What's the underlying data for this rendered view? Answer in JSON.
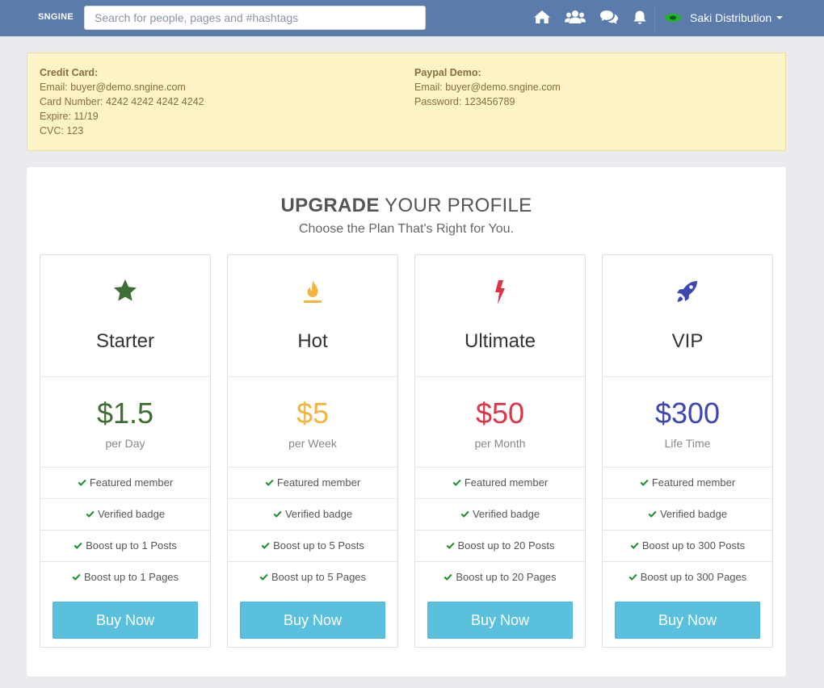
{
  "header": {
    "logo": "SNGINE",
    "search_placeholder": "Search for people, pages and #hashtags",
    "user_name": "Saki Distribution"
  },
  "demo_notice": {
    "credit_card": {
      "title": "Credit Card:",
      "email": "Email: buyer@demo.sngine.com",
      "card_number": "Card Number: 4242 4242 4242 4242",
      "expire": "Expire: 11/19",
      "cvc": "CVC: 123"
    },
    "paypal": {
      "title": "Paypal Demo:",
      "email": "Email: buyer@demo.sngine.com",
      "password": "Password: 123456789"
    }
  },
  "page": {
    "title_bold": "UPGRADE",
    "title_rest": " YOUR PROFILE",
    "subtitle": "Choose the Plan That's Right for You."
  },
  "plans": [
    {
      "name": "Starter",
      "price": "$1.5",
      "period": "per Day",
      "icon": "star-icon",
      "color": "#3e6f32",
      "features": [
        "Featured member",
        "Verified badge",
        "Boost up to 1 Posts",
        "Boost up to 1 Pages"
      ],
      "button": "Buy Now"
    },
    {
      "name": "Hot",
      "price": "$5",
      "period": "per Week",
      "icon": "fire-icon",
      "color": "#f4b43b",
      "features": [
        "Featured member",
        "Verified badge",
        "Boost up to 5 Posts",
        "Boost up to 5 Pages"
      ],
      "button": "Buy Now"
    },
    {
      "name": "Ultimate",
      "price": "$50",
      "period": "per Month",
      "icon": "bolt-icon",
      "color": "#dd3446",
      "features": [
        "Featured member",
        "Verified badge",
        "Boost up to 20 Posts",
        "Boost up to 20 Pages"
      ],
      "button": "Buy Now"
    },
    {
      "name": "VIP",
      "price": "$300",
      "period": "Life Time",
      "icon": "rocket-icon",
      "color": "#3c47b0",
      "features": [
        "Featured member",
        "Verified badge",
        "Boost up to 300 Posts",
        "Boost up to 300 Pages"
      ],
      "button": "Buy Now"
    }
  ]
}
